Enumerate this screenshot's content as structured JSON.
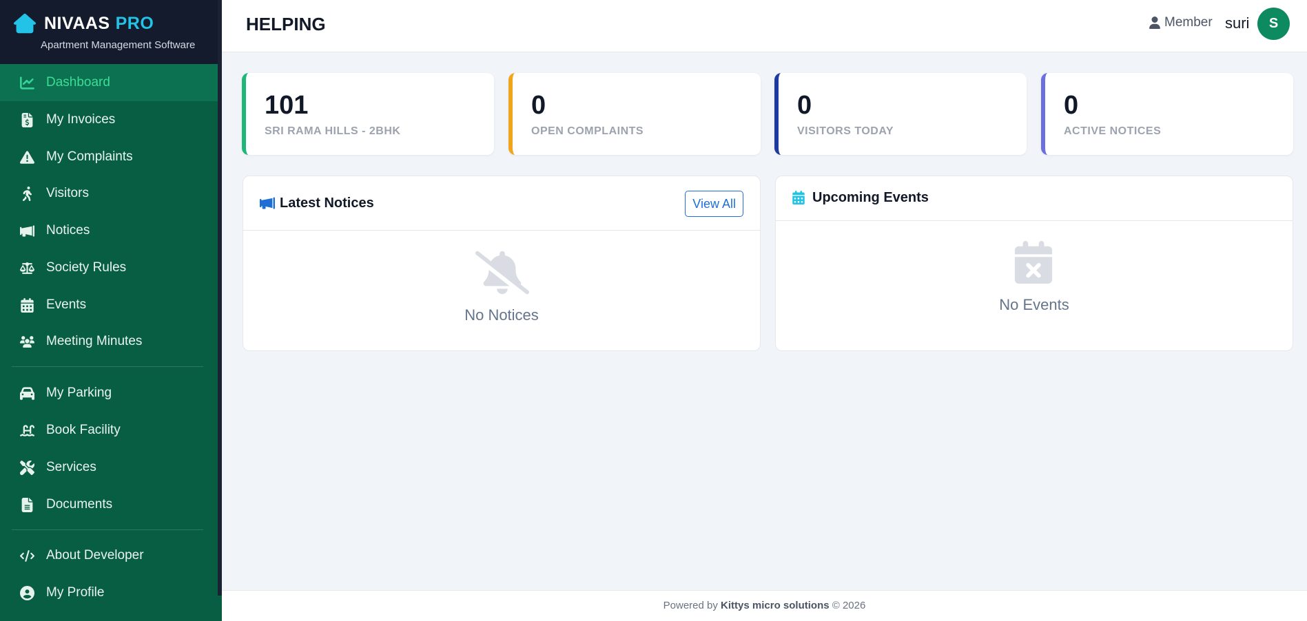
{
  "brand": {
    "name": "NIVAAS",
    "pro": "PRO",
    "subtitle": "Apartment Management Software"
  },
  "sidebar": {
    "items": [
      {
        "label": "Dashboard",
        "icon": "chart-line-icon",
        "active": true
      },
      {
        "label": "My Invoices",
        "icon": "invoice-icon"
      },
      {
        "label": "My Complaints",
        "icon": "warning-icon"
      },
      {
        "label": "Visitors",
        "icon": "walking-icon"
      },
      {
        "label": "Notices",
        "icon": "megaphone-icon"
      },
      {
        "label": "Society Rules",
        "icon": "scale-icon"
      },
      {
        "label": "Events",
        "icon": "calendar-icon"
      },
      {
        "label": "Meeting Minutes",
        "icon": "users-icon"
      },
      {
        "label": "My Parking",
        "icon": "car-icon"
      },
      {
        "label": "Book Facility",
        "icon": "pool-icon"
      },
      {
        "label": "Services",
        "icon": "tools-icon"
      },
      {
        "label": "Documents",
        "icon": "document-icon"
      },
      {
        "label": "About Developer",
        "icon": "code-icon"
      },
      {
        "label": "My Profile",
        "icon": "user-circle-icon"
      }
    ]
  },
  "header": {
    "title": "HELPING",
    "role": "Member",
    "username": "suri",
    "avatar_initial": "S"
  },
  "stats": [
    {
      "value": "101",
      "label": "SRI RAMA HILLS - 2BHK",
      "color": "#1fb67a"
    },
    {
      "value": "0",
      "label": "OPEN COMPLAINTS",
      "color": "#f0a51c"
    },
    {
      "value": "0",
      "label": "VISITORS TODAY",
      "color": "#1e3a9e"
    },
    {
      "value": "0",
      "label": "ACTIVE NOTICES",
      "color": "#6c6fe0"
    }
  ],
  "notices": {
    "title": "Latest Notices",
    "button": "View All",
    "empty": "No Notices"
  },
  "events": {
    "title": "Upcoming Events",
    "empty": "No Events"
  },
  "footer": {
    "prefix": "Powered by",
    "company": "Kittys micro solutions",
    "suffix": "© 2026"
  },
  "colors": {
    "sidebar_bg": "#075e43",
    "brand_bg": "#141b2d",
    "accent": "#22c3e6",
    "active": "#3ddc97",
    "link": "#1d6fd6"
  }
}
